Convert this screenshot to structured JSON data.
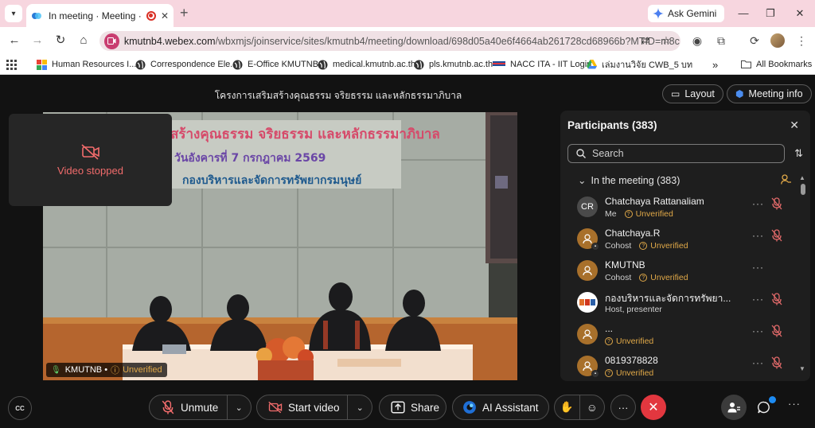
{
  "browser": {
    "tab_title": "In meeting · Meeting · Webex",
    "new_tab": "+",
    "gemini_label": "Ask Gemini",
    "url_host": "kmutnb4.webex.com",
    "url_path": "/wbxmjs/joinservice/sites/kmutnb4/meeting/download/698d05a40e6f4664ab261728cd68966b?MTID=m8c...",
    "bookmarks": [
      {
        "label": "Human Resources I..."
      },
      {
        "label": "Correspondence Ele..."
      },
      {
        "label": "E-Office KMUTNB"
      },
      {
        "label": "medical.kmutnb.ac.th"
      },
      {
        "label": "pls.kmutnb.ac.th"
      },
      {
        "label": "NACC ITA - IIT Login"
      },
      {
        "label": "เล่มงานวิจัย CWB_5 บท"
      }
    ],
    "more_bookmarks": "»",
    "all_bookmarks": "All Bookmarks"
  },
  "meeting": {
    "title": "โครงการเสริมสร้างคุณธรรม จริยธรรม และหลักธรรมาภิบาล",
    "layout_label": "Layout",
    "meeting_info_label": "Meeting info",
    "self_video_label": "Video stopped",
    "stage_banner": {
      "line1": "สร้างคุณธรรม จริยธรรม และหลักธรรมาภิบาล",
      "line2": "วันอังคารที่ 7 กรกฎาคม 2569",
      "line3": "กองบริหารและจัดการทรัพยากรมนุษย์"
    },
    "speaker_name": "KMUTNB •",
    "speaker_status": "Unverified"
  },
  "participants": {
    "title": "Participants (383)",
    "search_placeholder": "Search",
    "section_label": "In the meeting (383)",
    "list": [
      {
        "name": "Chatchaya Rattanaliam",
        "initials": "CR",
        "role": "Me",
        "status": "Unverified",
        "avatar": "initials",
        "mic_off": true
      },
      {
        "name": "Chatchaya.R",
        "initials": "",
        "role": "Cohost",
        "status": "Unverified",
        "avatar": "user",
        "mic_off": true
      },
      {
        "name": "KMUTNB",
        "initials": "",
        "role": "Cohost",
        "status": "Unverified",
        "avatar": "user",
        "mic_off": false
      },
      {
        "name": "กองบริหารและจัดการทรัพยา...",
        "initials": "",
        "role": "Host, presenter",
        "status": "",
        "avatar": "logo",
        "mic_off": true
      },
      {
        "name": "...",
        "initials": "",
        "role": "",
        "status": "Unverified",
        "avatar": "user",
        "mic_off": true
      },
      {
        "name": "0819378828",
        "initials": "",
        "role": "",
        "status": "Unverified",
        "avatar": "user",
        "mic_off": true
      }
    ]
  },
  "controls": {
    "cc_label": "CC",
    "unmute_label": "Unmute",
    "start_video_label": "Start video",
    "share_label": "Share",
    "ai_assistant_label": "AI Assistant"
  },
  "colors": {
    "accent_warning": "#e1a948",
    "end_call": "#e2373f",
    "muted_red": "#f26c6c"
  }
}
